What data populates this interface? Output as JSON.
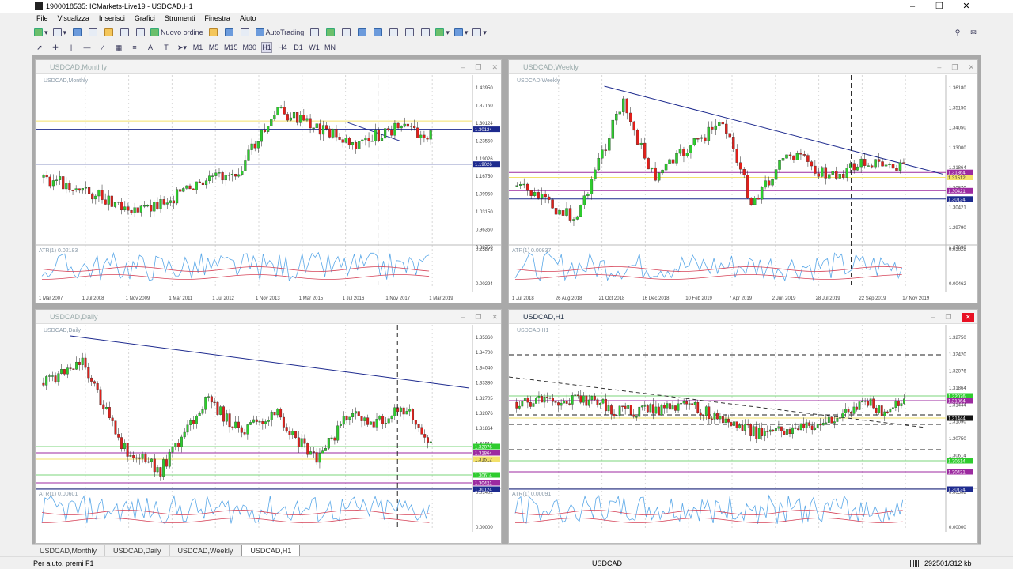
{
  "window_title": "1900018535: ICMarkets-Live19 - USDCAD,H1",
  "menu": [
    "File",
    "Visualizza",
    "Inserisci",
    "Grafici",
    "Strumenti",
    "Finestra",
    "Aiuto"
  ],
  "toolbar": {
    "new_order": "Nuovo ordine",
    "autotrading": "AutoTrading"
  },
  "timeframes": [
    "M1",
    "M5",
    "M15",
    "M30",
    "H1",
    "H4",
    "D1",
    "W1",
    "MN"
  ],
  "colors": {
    "bull": "#2ecc2e",
    "bear": "#e0201b",
    "trend": "#1d2a8e",
    "yellow": "#f3e16a",
    "magenta": "#9c2aa0",
    "green_line": "#7bd67b",
    "atr_blue": "#5aa8e8",
    "atr_red": "#d6455a"
  },
  "charts": [
    {
      "id": "monthly",
      "caption": "USDCAD,Monthly",
      "label": "USDCAD,Monthly",
      "atr_label": "ATR(1) 0.02183",
      "price_ticks": [
        "1.43950",
        "1.37150",
        "1.30124",
        "1.23550",
        "1.19026",
        "1.16750",
        "1.09950",
        "1.03150",
        "0.96350",
        "0.89750"
      ],
      "atr_ticks": [
        "0.25873",
        "0.00294"
      ],
      "date_ticks": [
        "1 Mar 2007",
        "1 Jul 2008",
        "1 Nov 2009",
        "1 Mar 2011",
        "1 Jul 2012",
        "1 Nov 2013",
        "1 Mar 2015",
        "1 Jul 2016",
        "1 Nov 2017",
        "1 Mar 2019"
      ],
      "price_badges": [
        {
          "text": "1.30124",
          "color": "#1d2a8e"
        },
        {
          "text": "1.19026",
          "color": "#1d2a8e"
        }
      ]
    },
    {
      "id": "weekly",
      "caption": "USDCAD,Weekly",
      "label": "USDCAD,Weekly",
      "atr_label": "ATR(1) 0.00837",
      "price_ticks": [
        "1.36180",
        "1.35150",
        "1.34050",
        "1.33000",
        "1.31864",
        "1.30870",
        "1.30421",
        "1.29790",
        "1.27690"
      ],
      "atr_ticks": [
        "0.03028",
        "0.00462"
      ],
      "date_ticks": [
        "1 Jul 2018",
        "26 Aug 2018",
        "21 Oct 2018",
        "16 Dec 2018",
        "10 Feb 2019",
        "7 Apr 2019",
        "2 Jun 2019",
        "28 Jul 2019",
        "22 Sep 2019",
        "17 Nov 2019"
      ],
      "price_badges": [
        {
          "text": "1.31864",
          "color": "#9c2aa0"
        },
        {
          "text": "1.31512",
          "color": "#f3e16a"
        },
        {
          "text": "1.30421",
          "color": "#9c2aa0"
        },
        {
          "text": "1.30124",
          "color": "#1d2a8e"
        }
      ]
    },
    {
      "id": "daily",
      "caption": "USDCAD,Daily",
      "label": "USDCAD,Daily",
      "atr_label": "ATR(1) 0.00601",
      "price_ticks": [
        "1.35360",
        "1.34700",
        "1.34040",
        "1.33380",
        "1.32705",
        "1.32076",
        "1.31864",
        "1.31512",
        "1.30614",
        "1.30421",
        "1.30124"
      ],
      "atr_ticks": [
        "0.01402",
        "0.00000"
      ],
      "date_ticks": [
        "",
        ""
      ],
      "price_badges": [
        {
          "text": "1.32076",
          "color": "#2ecc2e"
        },
        {
          "text": "1.31864",
          "color": "#9c2aa0"
        },
        {
          "text": "1.31512",
          "color": "#f3e16a"
        },
        {
          "text": "1.30614",
          "color": "#2ecc2e"
        },
        {
          "text": "1.30421",
          "color": "#9c2aa0"
        },
        {
          "text": "1.30124",
          "color": "#1d2a8e"
        }
      ]
    },
    {
      "id": "h1",
      "caption": "USDCAD,H1",
      "label": "USDCAD,H1",
      "atr_label": "ATR(1) 0.00091",
      "active": true,
      "price_ticks": [
        "1.32750",
        "1.32420",
        "1.32076",
        "1.31864",
        "1.31444",
        "1.31090",
        "1.30750",
        "1.30614",
        "1.30421",
        "1.30124"
      ],
      "atr_ticks": [
        "0.00508",
        "0.00000"
      ],
      "date_ticks": [
        "",
        ""
      ],
      "price_badges": [
        {
          "text": "1.32076",
          "color": "#2ecc2e"
        },
        {
          "text": "1.31864",
          "color": "#9c2aa0"
        },
        {
          "text": "1.31444",
          "color": "#111111"
        },
        {
          "text": "1.30614",
          "color": "#2ecc2e"
        },
        {
          "text": "1.30421",
          "color": "#9c2aa0"
        },
        {
          "text": "1.30124",
          "color": "#1d2a8e"
        }
      ]
    }
  ],
  "tabs": [
    "USDCAD,Monthly",
    "USDCAD,Daily",
    "USDCAD,Weekly",
    "USDCAD,H1"
  ],
  "active_tab": 3,
  "status": {
    "help": "Per aiuto, premi F1",
    "symbol": "USDCAD",
    "traffic": "292501/312 kb"
  }
}
